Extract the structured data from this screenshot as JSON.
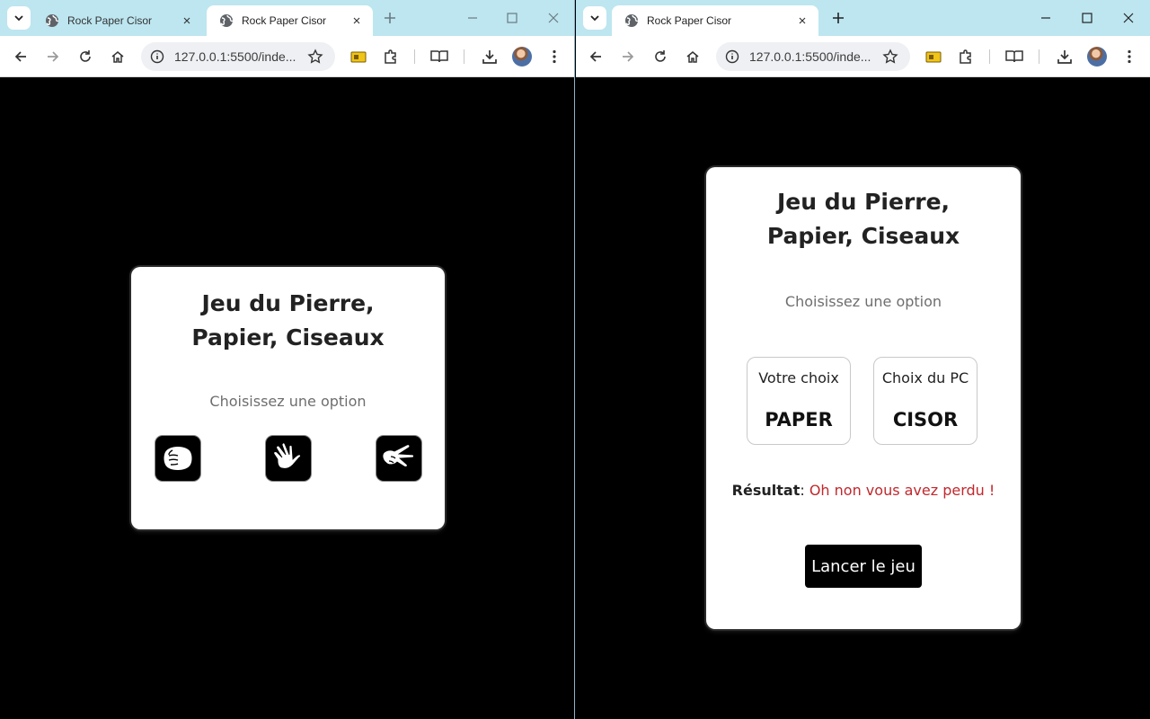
{
  "windows": {
    "left": {
      "tabs": [
        {
          "title": "Rock Paper Cisor",
          "active": false
        },
        {
          "title": "Rock Paper Cisor",
          "active": true
        }
      ],
      "url": "127.0.0.1:5500/inde...",
      "card": {
        "title": "Jeu du Pierre, Papier, Ciseaux",
        "subtitle": "Choisissez une option",
        "choices": [
          {
            "name": "rock",
            "icon": "rock-hand-icon"
          },
          {
            "name": "paper",
            "icon": "paper-hand-icon"
          },
          {
            "name": "scissors",
            "icon": "scissors-hand-icon"
          }
        ]
      }
    },
    "right": {
      "tabs": [
        {
          "title": "Rock Paper Cisor",
          "active": true
        }
      ],
      "url": "127.0.0.1:5500/inde...",
      "card": {
        "title": "Jeu du Pierre, Papier, Ciseaux",
        "subtitle": "Choisissez une option",
        "player_choice_label": "Votre choix",
        "player_choice_value": "PAPER",
        "pc_choice_label": "Choix du PC",
        "pc_choice_value": "CISOR",
        "result_label": "Résultat",
        "result_value": "Oh non vous avez perdu !",
        "play_button": "Lancer le jeu"
      }
    }
  },
  "colors": {
    "tabbar": "#bde6f0",
    "page_background": "#000000",
    "card_background": "#ffffff",
    "result_loss": "#c0282d",
    "play_button": "#000000"
  }
}
